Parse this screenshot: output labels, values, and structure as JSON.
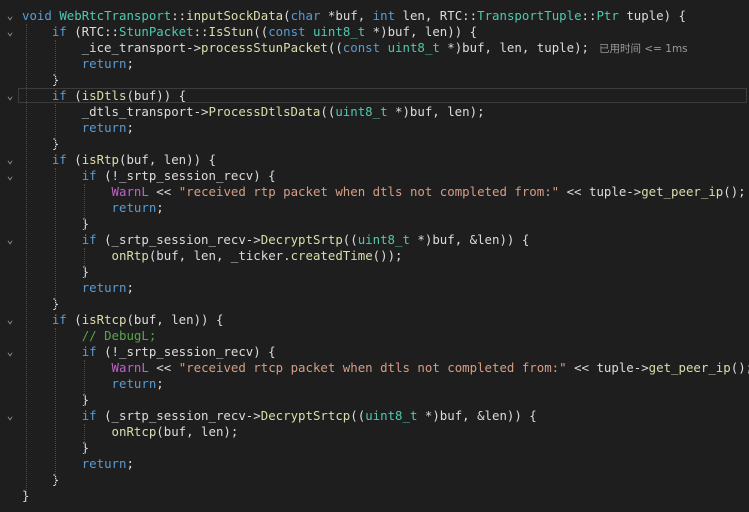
{
  "colors": {
    "plain": "#dcdcdc",
    "keyword": "#569cd6",
    "type": "#4ec9b0",
    "function": "#dcdcaa",
    "string": "#d69d85",
    "comment": "#57a64a",
    "macro": "#bd63c5",
    "hint": "#9a9a9a"
  },
  "fold_icons": {
    "open": "⌄",
    "close": "∨"
  },
  "code": {
    "lines": [
      {
        "fold": "open",
        "tokens": [
          [
            "keyword",
            "void"
          ],
          [
            "plain",
            " "
          ],
          [
            "type",
            "WebRtcTransport"
          ],
          [
            "plain",
            "::"
          ],
          [
            "function",
            "inputSockData"
          ],
          [
            "plain",
            "("
          ],
          [
            "keyword",
            "char"
          ],
          [
            "plain",
            " *buf, "
          ],
          [
            "keyword",
            "int"
          ],
          [
            "plain",
            " len, RTC::"
          ],
          [
            "type",
            "TransportTuple"
          ],
          [
            "plain",
            "::"
          ],
          [
            "type",
            "Ptr"
          ],
          [
            "plain",
            " tuple) {"
          ]
        ]
      },
      {
        "fold": "open",
        "tokens": [
          [
            "plain",
            "    "
          ],
          [
            "keyword",
            "if"
          ],
          [
            "plain",
            " (RTC::"
          ],
          [
            "type",
            "StunPacket"
          ],
          [
            "plain",
            "::"
          ],
          [
            "function",
            "IsStun"
          ],
          [
            "plain",
            "(("
          ],
          [
            "keyword",
            "const"
          ],
          [
            "plain",
            " "
          ],
          [
            "type",
            "uint8_t"
          ],
          [
            "plain",
            " *)buf, len)) {"
          ]
        ]
      },
      {
        "tokens": [
          [
            "plain",
            "        _ice_transport->"
          ],
          [
            "function",
            "processStunPacket"
          ],
          [
            "plain",
            "(("
          ],
          [
            "keyword",
            "const"
          ],
          [
            "plain",
            " "
          ],
          [
            "type",
            "uint8_t"
          ],
          [
            "plain",
            " *)buf, len, tuple);"
          ]
        ],
        "hint": "已用时间 <= 1ms"
      },
      {
        "tokens": [
          [
            "plain",
            "        "
          ],
          [
            "keyword",
            "return"
          ],
          [
            "plain",
            ";"
          ]
        ]
      },
      {
        "tokens": [
          [
            "plain",
            "    }"
          ]
        ]
      },
      {
        "fold": "open",
        "highlight": true,
        "tokens": [
          [
            "plain",
            "    "
          ],
          [
            "keyword",
            "if"
          ],
          [
            "plain",
            " ("
          ],
          [
            "function",
            "isDtls"
          ],
          [
            "plain",
            "(buf)) {"
          ]
        ]
      },
      {
        "tokens": [
          [
            "plain",
            "        _dtls_transport->"
          ],
          [
            "function",
            "ProcessDtlsData"
          ],
          [
            "plain",
            "(("
          ],
          [
            "type",
            "uint8_t"
          ],
          [
            "plain",
            " *)buf, len);"
          ]
        ]
      },
      {
        "tokens": [
          [
            "plain",
            "        "
          ],
          [
            "keyword",
            "return"
          ],
          [
            "plain",
            ";"
          ]
        ]
      },
      {
        "tokens": [
          [
            "plain",
            "    }"
          ]
        ]
      },
      {
        "fold": "open",
        "tokens": [
          [
            "plain",
            "    "
          ],
          [
            "keyword",
            "if"
          ],
          [
            "plain",
            " ("
          ],
          [
            "function",
            "isRtp"
          ],
          [
            "plain",
            "(buf, len)) {"
          ]
        ]
      },
      {
        "fold": "open",
        "tokens": [
          [
            "plain",
            "        "
          ],
          [
            "keyword",
            "if"
          ],
          [
            "plain",
            " (!_srtp_session_recv) {"
          ]
        ]
      },
      {
        "tokens": [
          [
            "plain",
            "            "
          ],
          [
            "macro",
            "WarnL"
          ],
          [
            "plain",
            " << "
          ],
          [
            "string",
            "\"received rtp packet when dtls not completed from:\""
          ],
          [
            "plain",
            " << tuple->"
          ],
          [
            "function",
            "get_peer_ip"
          ],
          [
            "plain",
            "();"
          ]
        ]
      },
      {
        "tokens": [
          [
            "plain",
            "            "
          ],
          [
            "keyword",
            "return"
          ],
          [
            "plain",
            ";"
          ]
        ]
      },
      {
        "tokens": [
          [
            "plain",
            "        }"
          ]
        ]
      },
      {
        "fold": "open",
        "tokens": [
          [
            "plain",
            "        "
          ],
          [
            "keyword",
            "if"
          ],
          [
            "plain",
            " (_srtp_session_recv->"
          ],
          [
            "function",
            "DecryptSrtp"
          ],
          [
            "plain",
            "(("
          ],
          [
            "type",
            "uint8_t"
          ],
          [
            "plain",
            " *)buf, &len)) {"
          ]
        ]
      },
      {
        "tokens": [
          [
            "plain",
            "            "
          ],
          [
            "function",
            "onRtp"
          ],
          [
            "plain",
            "(buf, len, _ticker."
          ],
          [
            "function",
            "createdTime"
          ],
          [
            "plain",
            "());"
          ]
        ]
      },
      {
        "tokens": [
          [
            "plain",
            "        }"
          ]
        ]
      },
      {
        "tokens": [
          [
            "plain",
            "        "
          ],
          [
            "keyword",
            "return"
          ],
          [
            "plain",
            ";"
          ]
        ]
      },
      {
        "tokens": [
          [
            "plain",
            "    }"
          ]
        ]
      },
      {
        "fold": "open",
        "tokens": [
          [
            "plain",
            "    "
          ],
          [
            "keyword",
            "if"
          ],
          [
            "plain",
            " ("
          ],
          [
            "function",
            "isRtcp"
          ],
          [
            "plain",
            "(buf, len)) {"
          ]
        ]
      },
      {
        "tokens": [
          [
            "plain",
            "        "
          ],
          [
            "comment",
            "// DebugL;"
          ]
        ]
      },
      {
        "fold": "open",
        "tokens": [
          [
            "plain",
            "        "
          ],
          [
            "keyword",
            "if"
          ],
          [
            "plain",
            " (!_srtp_session_recv) {"
          ]
        ]
      },
      {
        "tokens": [
          [
            "plain",
            "            "
          ],
          [
            "macro",
            "WarnL"
          ],
          [
            "plain",
            " << "
          ],
          [
            "string",
            "\"received rtcp packet when dtls not completed from:\""
          ],
          [
            "plain",
            " << tuple->"
          ],
          [
            "function",
            "get_peer_ip"
          ],
          [
            "plain",
            "();"
          ]
        ]
      },
      {
        "tokens": [
          [
            "plain",
            "            "
          ],
          [
            "keyword",
            "return"
          ],
          [
            "plain",
            ";"
          ]
        ]
      },
      {
        "tokens": [
          [
            "plain",
            "        }"
          ]
        ]
      },
      {
        "fold": "open",
        "tokens": [
          [
            "plain",
            "        "
          ],
          [
            "keyword",
            "if"
          ],
          [
            "plain",
            " (_srtp_session_recv->"
          ],
          [
            "function",
            "DecryptSrtcp"
          ],
          [
            "plain",
            "(("
          ],
          [
            "type",
            "uint8_t"
          ],
          [
            "plain",
            " *)buf, &len)) {"
          ]
        ]
      },
      {
        "tokens": [
          [
            "plain",
            "            "
          ],
          [
            "function",
            "onRtcp"
          ],
          [
            "plain",
            "(buf, len);"
          ]
        ]
      },
      {
        "tokens": [
          [
            "plain",
            "        }"
          ]
        ]
      },
      {
        "tokens": [
          [
            "plain",
            "        "
          ],
          [
            "keyword",
            "return"
          ],
          [
            "plain",
            ";"
          ]
        ]
      },
      {
        "tokens": [
          [
            "plain",
            "    }"
          ]
        ]
      },
      {
        "tokens": [
          [
            "plain",
            "}"
          ]
        ]
      }
    ]
  }
}
